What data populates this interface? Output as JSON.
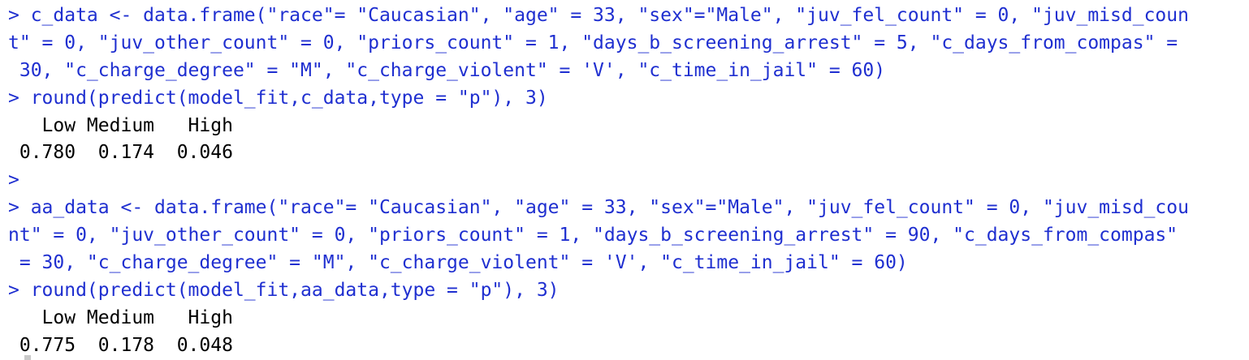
{
  "console": {
    "lines": [
      {
        "text": "> c_data <- data.frame(\"race\"= \"Caucasian\", \"age\" = 33, \"sex\"=\"Male\", \"juv_fel_count\" = 0, \"juv_misd_coun",
        "kind": "input"
      },
      {
        "text": "t\" = 0, \"juv_other_count\" = 0, \"priors_count\" = 1, \"days_b_screening_arrest\" = 5, \"c_days_from_compas\" =",
        "kind": "input"
      },
      {
        "text": " 30, \"c_charge_degree\" = \"M\", \"c_charge_violent\" = 'V', \"c_time_in_jail\" = 60)",
        "kind": "input"
      },
      {
        "text": "> round(predict(model_fit,c_data,type = \"p\"), 3)",
        "kind": "input"
      },
      {
        "text": "   Low Medium   High",
        "kind": "output"
      },
      {
        "text": " 0.780  0.174  0.046",
        "kind": "output"
      },
      {
        "text": ">",
        "kind": "input"
      },
      {
        "text": "> aa_data <- data.frame(\"race\"= \"Caucasian\", \"age\" = 33, \"sex\"=\"Male\", \"juv_fel_count\" = 0, \"juv_misd_cou",
        "kind": "input"
      },
      {
        "text": "nt\" = 0, \"juv_other_count\" = 0, \"priors_count\" = 1, \"days_b_screening_arrest\" = 90, \"c_days_from_compas\"",
        "kind": "input"
      },
      {
        "text": " = 30, \"c_charge_degree\" = \"M\", \"c_charge_violent\" = 'V', \"c_time_in_jail\" = 60)",
        "kind": "input"
      },
      {
        "text": "> round(predict(model_fit,aa_data,type = \"p\"), 3)",
        "kind": "input"
      },
      {
        "text": "   Low Medium   High",
        "kind": "output"
      },
      {
        "text": " 0.775  0.178  0.048",
        "kind": "output"
      }
    ]
  },
  "colors": {
    "input": "#1f2fd0",
    "output": "#000000",
    "background": "#ffffff"
  }
}
